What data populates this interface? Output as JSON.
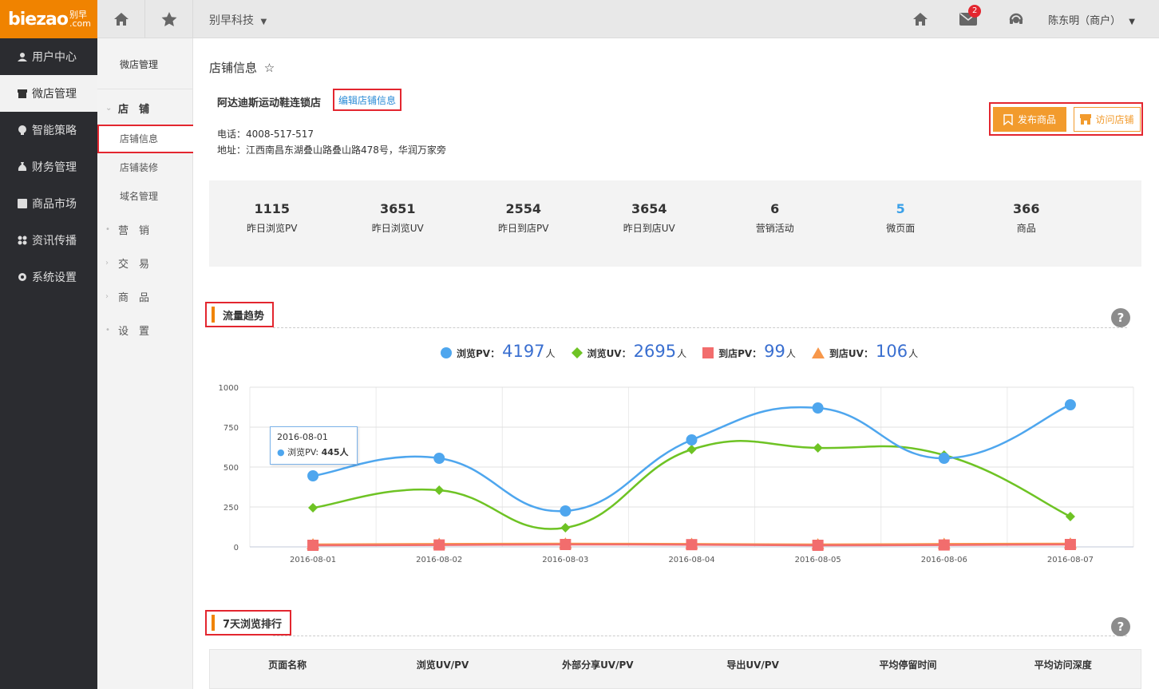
{
  "brand": {
    "logo_main": "biezao",
    "logo_cn": "别早",
    "logo_domain": ".com"
  },
  "sidebar": {
    "items": [
      {
        "label": "用户中心",
        "icon": "user-icon"
      },
      {
        "label": "微店管理",
        "icon": "store-icon",
        "active": true
      },
      {
        "label": "智能策略",
        "icon": "bulb-icon"
      },
      {
        "label": "财务管理",
        "icon": "money-bag-icon"
      },
      {
        "label": "商品市场",
        "icon": "market-icon"
      },
      {
        "label": "资讯传播",
        "icon": "grid-icon"
      },
      {
        "label": "系统设置",
        "icon": "gear-icon"
      }
    ]
  },
  "subnav": {
    "title": "微店管理",
    "group_store": "店　铺",
    "store_links": [
      "店铺信息",
      "店铺装修",
      "域名管理"
    ],
    "groups": [
      "营　销",
      "交　易",
      "商　品",
      "设　置"
    ]
  },
  "topbar": {
    "company": "别早科技",
    "notifications": "2",
    "user": "陈东明（商户）"
  },
  "store": {
    "page_title": "店铺信息",
    "name": "阿达迪斯运动鞋连锁店",
    "edit_link": "编辑店铺信息",
    "phone": "电话：4008-517-517",
    "address": "地址：江西南昌东湖叠山路叠山路478号，华润万家旁",
    "publish_btn": "发布商品",
    "visit_btn": "访问店铺"
  },
  "stats": [
    {
      "value": "1115",
      "label": "昨日浏览PV"
    },
    {
      "value": "3651",
      "label": "昨日浏览UV"
    },
    {
      "value": "2554",
      "label": "昨日到店PV"
    },
    {
      "value": "3654",
      "label": "昨日到店UV"
    },
    {
      "value": "6",
      "label": "营销活动"
    },
    {
      "value": "5",
      "label": "微页面"
    },
    {
      "value": "366",
      "label": "商品"
    }
  ],
  "traffic": {
    "title": "流量趋势",
    "help": "?",
    "legend": [
      {
        "label": "浏览PV：",
        "value": "4197",
        "unit": "人",
        "color": "#4ea6ee"
      },
      {
        "label": "浏览UV：",
        "value": "2695",
        "unit": "人",
        "color": "#6ec324"
      },
      {
        "label": "到店PV：",
        "value": "99",
        "unit": "人",
        "color": "#f26d6d"
      },
      {
        "label": "到店UV：",
        "value": "106",
        "unit": "人",
        "color": "#f7974a"
      }
    ],
    "tooltip": {
      "date": "2016-08-01",
      "series": "浏览PV:",
      "value": "445人"
    }
  },
  "chart_data": {
    "type": "line",
    "x": [
      "2016-08-01",
      "2016-08-02",
      "2016-08-03",
      "2016-08-04",
      "2016-08-05",
      "2016-08-06",
      "2016-08-07"
    ],
    "yticks": [
      "1000",
      "750",
      "500",
      "250",
      "0"
    ],
    "ylim": [
      0,
      1000
    ],
    "grid": true,
    "series": [
      {
        "name": "浏览PV",
        "color": "#4ea6ee",
        "marker": "circle",
        "values": [
          445,
          555,
          225,
          670,
          870,
          555,
          890
        ]
      },
      {
        "name": "浏览UV",
        "color": "#6ec324",
        "marker": "diamond",
        "values": [
          245,
          355,
          120,
          610,
          620,
          575,
          190
        ]
      },
      {
        "name": "到店PV",
        "color": "#f26d6d",
        "marker": "square",
        "values": [
          10,
          12,
          15,
          14,
          10,
          12,
          15
        ]
      },
      {
        "name": "到店UV",
        "color": "#f7974a",
        "marker": "triangle",
        "values": [
          15,
          18,
          20,
          18,
          15,
          18,
          20
        ]
      }
    ]
  },
  "ranking": {
    "title": "7天浏览排行",
    "help": "?",
    "columns": [
      "页面名称",
      "浏览UV/PV",
      "外部分享UV/PV",
      "导出UV/PV",
      "平均停留时间",
      "平均访问深度"
    ]
  }
}
